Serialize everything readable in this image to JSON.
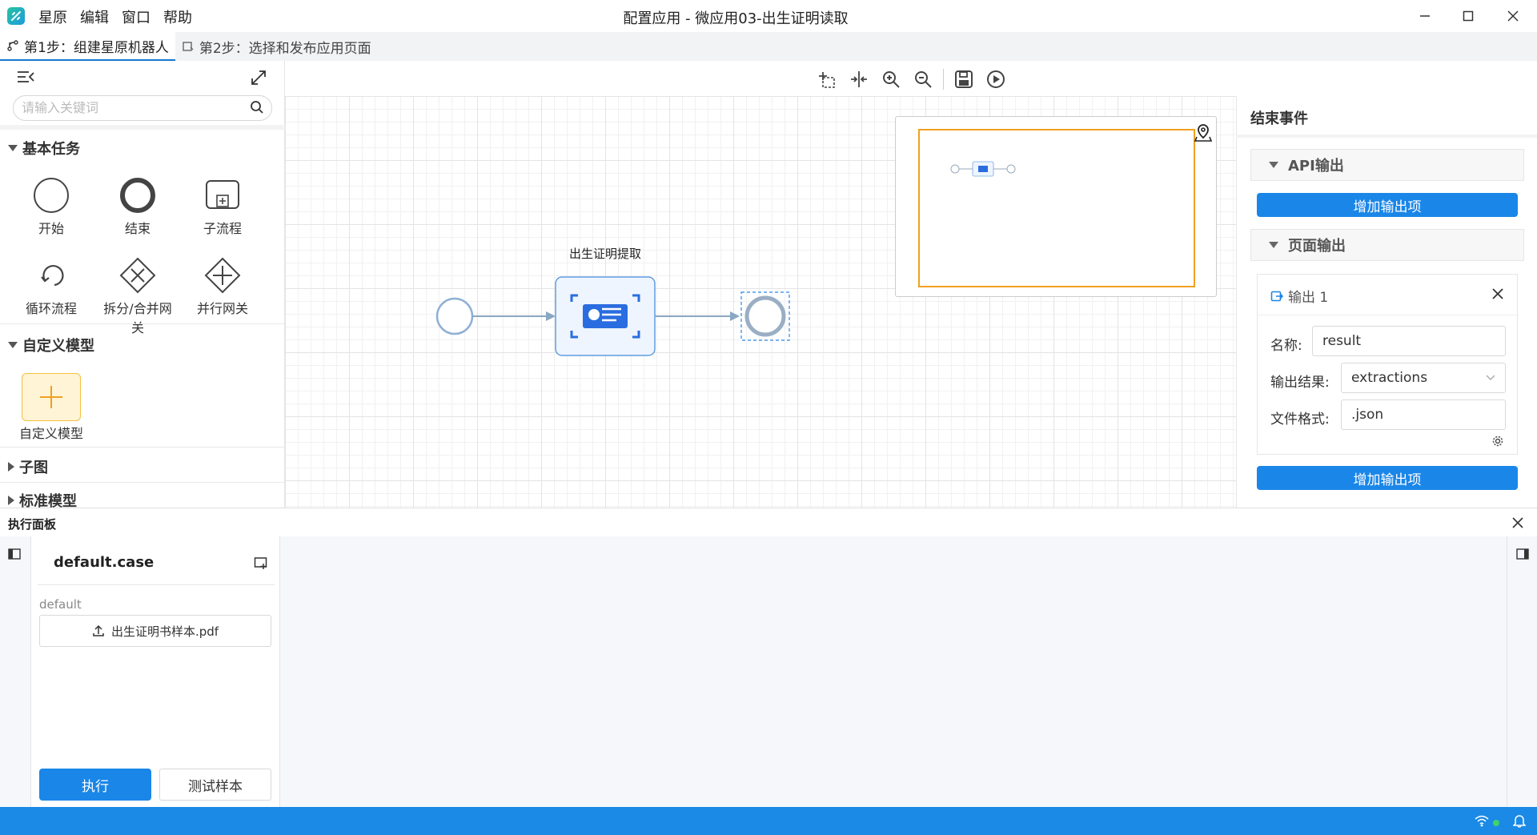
{
  "app": {
    "menu": [
      "星原",
      "编辑",
      "窗口",
      "帮助"
    ],
    "window_title": "配置应用 - 微应用03-出生证明读取"
  },
  "steps": [
    {
      "label": "第1步：组建星原机器人",
      "active": true
    },
    {
      "label": "第2步：选择和发布应用页面",
      "active": false
    }
  ],
  "left_panel": {
    "search_placeholder": "请输入关键词",
    "sections": {
      "basic": "基本任务",
      "custom": "自定义模型",
      "subgraph": "子图",
      "standard": "标准模型"
    },
    "basic_tools": [
      "开始",
      "结束",
      "子流程",
      "循环流程",
      "拆分/合并网关",
      "并行网关"
    ],
    "custom_tools": [
      "自定义模型"
    ]
  },
  "canvas": {
    "task_label": "出生证明提取"
  },
  "right_panel": {
    "title": "结束事件",
    "api_section": "API输出",
    "add_output_label": "增加输出项",
    "page_section": "页面输出",
    "output_card": {
      "title": "输出 1",
      "name_label": "名称:",
      "name_value": "result",
      "result_label": "输出结果:",
      "result_value": "extractions",
      "format_label": "文件格式:",
      "format_value": ".json"
    },
    "add_output_label_2": "增加输出项"
  },
  "exec_panel": {
    "title": "执行面板",
    "case_name": "default.case",
    "group_label": "default",
    "file_name": "出生证明书样本.pdf",
    "run_label": "执行",
    "test_label": "测试样本"
  },
  "colors": {
    "accent": "#1a86e8",
    "status_bar": "#1a8ae6",
    "minimap_view": "#f0a020",
    "custom_model_bg": "#fff4d6"
  }
}
